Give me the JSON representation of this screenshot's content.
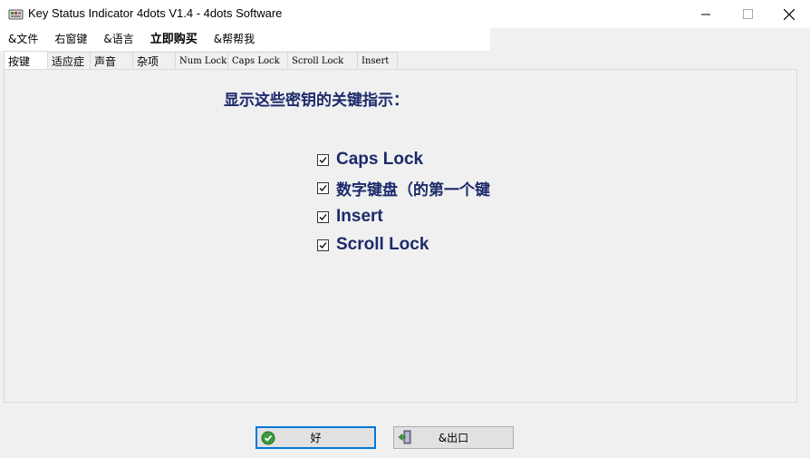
{
  "window": {
    "title": "Key Status Indicator 4dots V1.4 - 4dots Software"
  },
  "menu": {
    "items": [
      "&文件",
      "右窗键",
      "&语言",
      "立即购买",
      "&帮帮我"
    ]
  },
  "tabs": [
    {
      "label": "按键",
      "active": true
    },
    {
      "label": "适应症",
      "active": false
    },
    {
      "label": "声音",
      "active": false
    },
    {
      "label": "杂项",
      "active": false
    },
    {
      "label": "Num Lock",
      "active": false
    },
    {
      "label": "Caps Lock",
      "active": false
    },
    {
      "label": "Scroll Lock",
      "active": false
    },
    {
      "label": "Insert",
      "active": false
    }
  ],
  "panel": {
    "heading": "显示这些密钥的关键指示：",
    "options": [
      {
        "label": "Caps Lock",
        "checked": true
      },
      {
        "label": "数字键盘（的第一个键",
        "checked": true
      },
      {
        "label": "Insert",
        "checked": true
      },
      {
        "label": "Scroll Lock",
        "checked": true
      }
    ]
  },
  "buttons": {
    "ok_label": "好",
    "exit_label": "&出口"
  },
  "colors": {
    "label_text": "#1c2a6b",
    "default_button_border": "#0078d7"
  }
}
